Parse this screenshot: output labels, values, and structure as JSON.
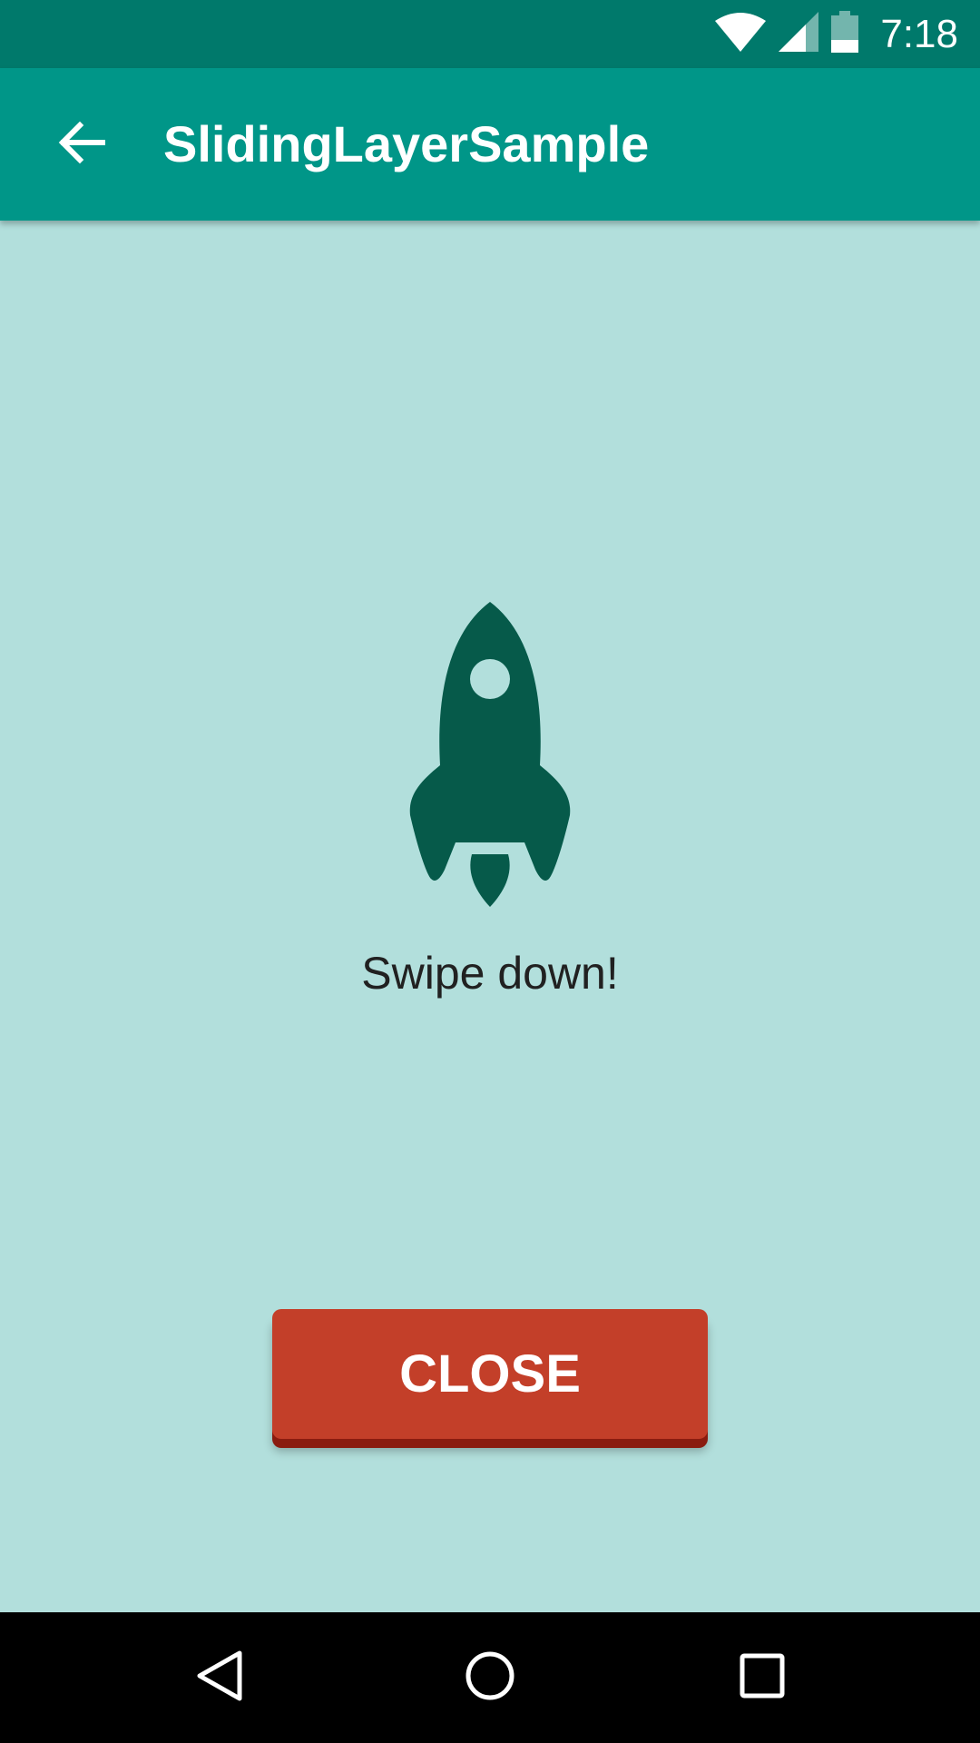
{
  "status_bar": {
    "time": "7:18",
    "icons": [
      "wifi-icon",
      "cell-signal-icon",
      "battery-icon"
    ]
  },
  "app_bar": {
    "title": "SlidingLayerSample",
    "back_icon": "arrow-back-icon"
  },
  "content": {
    "icon": "rocket-icon",
    "hint": "Swipe down!",
    "close_label": "CLOSE"
  },
  "nav_bar": {
    "buttons": [
      "back-triangle-icon",
      "home-circle-icon",
      "recents-square-icon"
    ]
  },
  "colors": {
    "status_bar": "#00796b",
    "app_bar": "#009688",
    "background": "#b2dfdc",
    "rocket": "#065a4a",
    "close_button": "#c33f29",
    "close_button_shadow": "#8a1c10"
  }
}
